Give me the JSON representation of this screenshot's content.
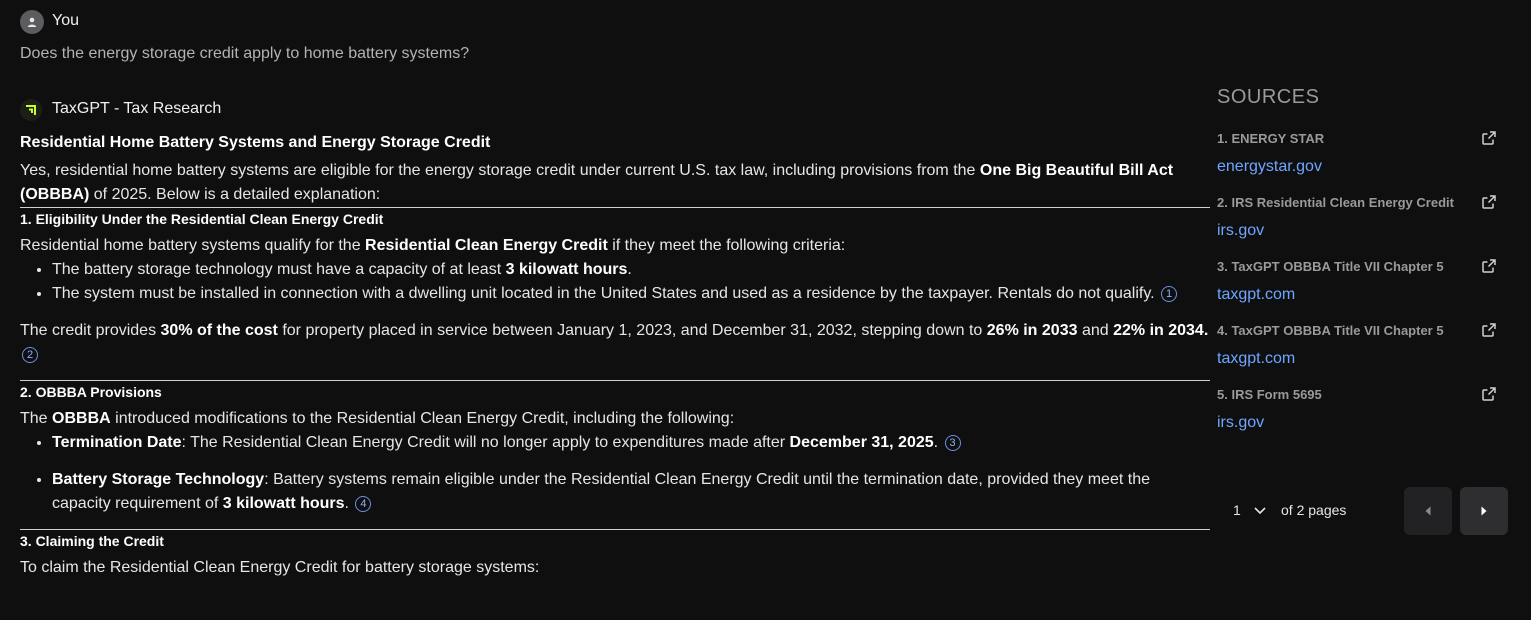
{
  "user": {
    "name": "You",
    "question": "Does the energy storage credit apply to home battery systems?"
  },
  "assistant": {
    "name": "TaxGPT - Tax Research"
  },
  "answer": {
    "title": "Residential Home Battery Systems and Energy Storage Credit",
    "intro_1": "Yes, residential home battery systems are eligible for the energy storage credit under current U.S. tax law, including provisions from the ",
    "intro_bold": "One Big Beautiful Bill Act (OBBBA)",
    "intro_2": " of 2025. Below is a detailed explanation:",
    "s1": {
      "heading": "1. Eligibility Under the Residential Clean Energy Credit",
      "lead_1": "Residential home battery systems qualify for the ",
      "lead_bold": "Residential Clean Energy Credit",
      "lead_2": " if they meet the following criteria:",
      "b1_1": "The battery storage technology must have a capacity of at least ",
      "b1_bold": "3 kilowatt hours",
      "b1_2": ".",
      "b2": "The system must be installed in connection with a dwelling unit located in the United States and used as a residence by the taxpayer. Rentals do not qualify.",
      "b2_cite": "1",
      "p_1": "The credit provides ",
      "p_bold1": "30% of the cost",
      "p_2": " for property placed in service between January 1, 2023, and December 31, 2032, stepping down to ",
      "p_bold2": "26% in 2033",
      "p_3": " and ",
      "p_bold3": "22% in 2034.",
      "p_cite": "2"
    },
    "s2": {
      "heading": "2. OBBBA Provisions",
      "lead_1": "The ",
      "lead_bold": "OBBBA",
      "lead_2": " introduced modifications to the Residential Clean Energy Credit, including the following:",
      "b1_bold": "Termination Date",
      "b1_1": ": The Residential Clean Energy Credit will no longer apply to expenditures made after ",
      "b1_bold2": "December 31, 2025",
      "b1_2": ".",
      "b1_cite": "3",
      "b2_bold": "Battery Storage Technology",
      "b2_1": ": Battery systems remain eligible under the Residential Clean Energy Credit until the termination date, provided they meet the capacity requirement of ",
      "b2_bold2": "3 kilowatt hours",
      "b2_2": ".",
      "b2_cite": "4"
    },
    "s3": {
      "heading": "3. Claiming the Credit",
      "lead": "To claim the Residential Clean Energy Credit for battery storage systems:"
    }
  },
  "sources": {
    "title": "SOURCES",
    "items": [
      {
        "label": "1. ENERGY STAR",
        "domain": "energystar.gov"
      },
      {
        "label": "2. IRS Residential Clean Energy Credit",
        "domain": "irs.gov"
      },
      {
        "label": "3. TaxGPT OBBBA Title VII Chapter 5",
        "domain": "taxgpt.com"
      },
      {
        "label": "4. TaxGPT OBBBA Title VII Chapter 5",
        "domain": "taxgpt.com"
      },
      {
        "label": "5. IRS Form 5695",
        "domain": "irs.gov"
      }
    ],
    "pager": {
      "current": "1",
      "of_label": "of 2 pages"
    }
  },
  "colors": {
    "link": "#6ea6ff",
    "accent": "#c9ff2e",
    "background": "#0f0f10"
  }
}
